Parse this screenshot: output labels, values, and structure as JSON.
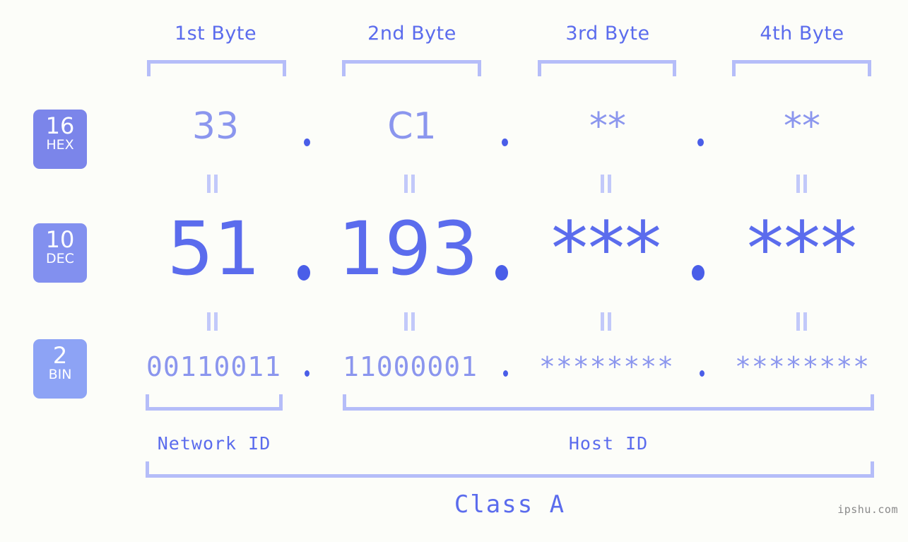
{
  "meta": {
    "watermark": "ipshu.com",
    "background_color": "#fcfdf9",
    "accent_color": "#5b6ced",
    "muted_accent_color": "#8b96ee",
    "bracket_color": "#b5bdf9"
  },
  "byte_headers": [
    {
      "label": "1st Byte"
    },
    {
      "label": "2nd Byte"
    },
    {
      "label": "3rd Byte"
    },
    {
      "label": "4th Byte"
    }
  ],
  "bases": [
    {
      "number": "16",
      "name": "HEX",
      "color": "#7b85ea"
    },
    {
      "number": "10",
      "name": "DEC",
      "color": "#8290ef"
    },
    {
      "number": "2",
      "name": "BIN",
      "color": "#8da3f5"
    }
  ],
  "rows": {
    "hex": {
      "values": [
        "33",
        "C1",
        "**",
        "**"
      ],
      "separator": "."
    },
    "dec": {
      "values": [
        "51",
        "193",
        "***",
        "***"
      ],
      "separator": "."
    },
    "bin": {
      "values": [
        "00110011",
        "11000001",
        "********",
        "********"
      ],
      "separator": "."
    }
  },
  "equals_marks": {
    "symbol": "||"
  },
  "segments": {
    "network": {
      "label": "Network ID"
    },
    "host": {
      "label": "Host ID"
    },
    "class": {
      "label": "Class A"
    }
  }
}
